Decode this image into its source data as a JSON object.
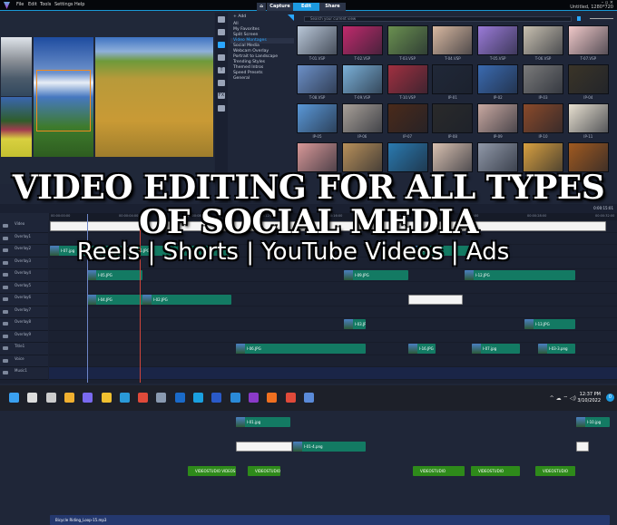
{
  "menubar": {
    "items": [
      "File",
      "Edit",
      "Tools",
      "Settings",
      "Help"
    ],
    "tabs": [
      "Capture",
      "Edit",
      "Share"
    ],
    "active_tab": "Edit",
    "project": "Untitled, 1280*720",
    "window_controls": "– ▫ ×"
  },
  "library": {
    "add_label": "Add",
    "categories": [
      "All",
      "My Favorites",
      "Split Screen",
      "Video Montages",
      "Social Media",
      "Webcam Overlay",
      "Portrait to Landscape",
      "Trending Styles",
      "Themed Intros",
      "Speed Presets",
      "General"
    ],
    "selected_category": "Video Montages",
    "search_placeholder": "Search your current view",
    "thumbnails": [
      "T-01.VSP",
      "T-02.VSP",
      "T-03.VSP",
      "T-04.VSP",
      "T-05.VSP",
      "T-06.VSP",
      "T-07.VSP",
      "T-08.VSP",
      "T-09.VSP",
      "T-10.VSP",
      "IP-01",
      "IP-02",
      "IP-03",
      "IP-04",
      "IP-05",
      "IP-06",
      "IP-07",
      "IP-08",
      "IP-09",
      "IP-10",
      "IP-11",
      "",
      "",
      "",
      "",
      "",
      "",
      ""
    ]
  },
  "overlay": {
    "headline_line1": "VIDEO EDITING FOR ALL TYPES",
    "headline_line2": "OF SOCIAL MEDIA",
    "subline": "Reels | Shorts | YouTube Videos | Ads"
  },
  "timeline": {
    "ruler": [
      "00:00:00:00",
      "00:00:04:00",
      "00:00:08:00",
      "00:00:12:00",
      "00:00:16:00",
      "00:00:20:00",
      "00:00:24:00",
      "00:00:28:00",
      "00:00:32:00"
    ],
    "timecode": "0:00:15:01",
    "tracks": [
      "Video",
      "Overlay1",
      "Overlay2",
      "Overlay3",
      "Overlay4",
      "Overlay5",
      "Overlay6",
      "Overlay7",
      "Overlay8",
      "Overlay9",
      "Title1",
      "Voice",
      "Music1"
    ],
    "clips": [
      {
        "track": 0,
        "type": "white",
        "label": ""
      },
      {
        "track": 1,
        "type": "teal",
        "label": "I-07.jpg"
      },
      {
        "track": 1,
        "type": "teal",
        "label": "I-05.JPG"
      },
      {
        "track": 1,
        "type": "teal",
        "label": "I-11.JPG"
      },
      {
        "track": 2,
        "type": "teal",
        "label": "I-05.JPG"
      },
      {
        "track": 2,
        "type": "teal",
        "label": "I-09.JPG"
      },
      {
        "track": 2,
        "type": "teal",
        "label": "I-12.JPG"
      },
      {
        "track": 3,
        "type": "teal",
        "label": "I-04.JPG"
      },
      {
        "track": 3,
        "type": "teal",
        "label": "I-02.JPG"
      },
      {
        "track": 3,
        "type": "white",
        "label": ""
      },
      {
        "track": 4,
        "type": "teal",
        "label": "I-03.JPG"
      },
      {
        "track": 4,
        "type": "teal",
        "label": "I-13.JPG"
      },
      {
        "track": 5,
        "type": "teal",
        "label": "I-06.JPG"
      },
      {
        "track": 5,
        "type": "teal",
        "label": "I-16.JPG"
      },
      {
        "track": 5,
        "type": "teal",
        "label": "I-07.jpg"
      },
      {
        "track": 5,
        "type": "teal",
        "label": "I-03-3.png"
      },
      {
        "track": 6,
        "type": "teal",
        "label": "I-08.jpg"
      },
      {
        "track": 6,
        "type": "white",
        "label": ""
      },
      {
        "track": 7,
        "type": "teal",
        "label": "I-01-1.png"
      },
      {
        "track": 7,
        "type": "white",
        "label": ""
      },
      {
        "track": 7,
        "type": "teal",
        "label": "I-09.jpg"
      },
      {
        "track": 8,
        "type": "teal",
        "label": "I-01.jpg"
      },
      {
        "track": 8,
        "type": "teal",
        "label": "I-10.jpg"
      },
      {
        "track": 9,
        "type": "white",
        "label": ""
      },
      {
        "track": 9,
        "type": "teal",
        "label": "I-01-4.png"
      },
      {
        "track": 9,
        "type": "white",
        "label": ""
      },
      {
        "track": 10,
        "type": "green",
        "label": "VIDEOSTUDIO VIDEOS"
      },
      {
        "track": 10,
        "type": "green",
        "label": "VIDEOSTUDIO"
      },
      {
        "track": 10,
        "type": "green",
        "label": "VIDEOSTUDIO"
      },
      {
        "track": 10,
        "type": "green",
        "label": "VIDEOSTUDIO"
      },
      {
        "track": 10,
        "type": "green",
        "label": "VIDEOSTUDIO"
      },
      {
        "track": 12,
        "type": "music",
        "label": "Bicycle Riding_Loop-15.mp3"
      }
    ]
  },
  "taskbar": {
    "apps": [
      "start-icon",
      "search-icon",
      "task-view-icon",
      "weather-icon",
      "teams-icon",
      "file-explorer-icon",
      "edge-icon",
      "store-icon",
      "settings-icon",
      "outlook-icon",
      "cortana-icon",
      "word-icon",
      "publisher-icon",
      "onenote-icon",
      "firefox-icon",
      "chrome-icon",
      "videostudio-icon"
    ],
    "time": "12:37 PM",
    "date": "3/10/2022",
    "notifications": "0"
  },
  "colors": {
    "accent": "#1c9ae0",
    "clip_teal": "#137a63",
    "clip_title": "#2e8a1a",
    "playhead": "#d0453a"
  }
}
